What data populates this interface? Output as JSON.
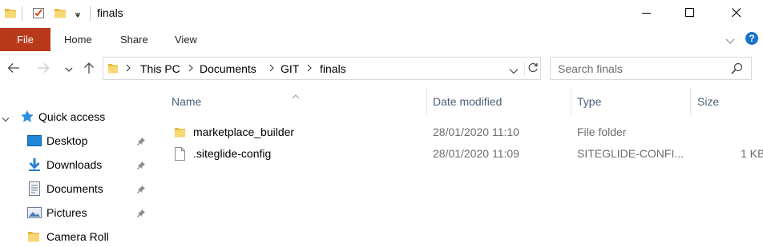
{
  "window": {
    "title": "finals",
    "minimize_icon": "minimize-icon",
    "maximize_icon": "maximize-icon",
    "close_icon": "close-icon"
  },
  "ribbon": {
    "tabs": [
      {
        "label": "File"
      },
      {
        "label": "Home"
      },
      {
        "label": "Share"
      },
      {
        "label": "View"
      }
    ],
    "help_label": "?",
    "accent": "#b83a1b"
  },
  "address": {
    "crumbs": [
      "This PC",
      "Documents",
      "GIT",
      "finals"
    ],
    "search_placeholder": "Search finals"
  },
  "nav_pane": {
    "quick_access_label": "Quick access",
    "items": [
      {
        "label": "Desktop",
        "icon": "desktop-icon",
        "pinned": true
      },
      {
        "label": "Downloads",
        "icon": "downloads-icon",
        "pinned": true
      },
      {
        "label": "Documents",
        "icon": "documents-icon",
        "pinned": true
      },
      {
        "label": "Pictures",
        "icon": "pictures-icon",
        "pinned": true
      },
      {
        "label": "Camera Roll",
        "icon": "folder-icon",
        "pinned": false
      }
    ]
  },
  "files": {
    "columns": {
      "name": "Name",
      "date": "Date modified",
      "type": "Type",
      "size": "Size"
    },
    "rows": [
      {
        "name": "marketplace_builder",
        "date": "28/01/2020 11:10",
        "type": "File folder",
        "size": "",
        "icon": "folder-icon"
      },
      {
        "name": ".siteglide-config",
        "date": "28/01/2020 11:09",
        "type": "SITEGLIDE-CONFI...",
        "size": "1 KB",
        "icon": "file-icon"
      }
    ]
  }
}
